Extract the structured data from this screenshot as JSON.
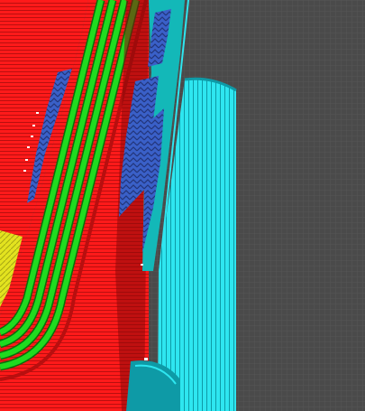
{
  "viewer": {
    "kind": "3d-print-slicer-layer-preview",
    "palette": {
      "background": "#4a4a4a",
      "grid_line": "#565656",
      "outer_wall": "#ff1a1a",
      "outer_wall_dark": "#b80f0f",
      "inner_wall": "#1fdb1f",
      "inner_wall_dark": "#0a6e0a",
      "support": "#3a60c8",
      "support_dark": "#22357a",
      "skirt_teal": "#13b8b8",
      "cyan_wall": "#2ee6f0",
      "cyan_wall_dark": "#0e9aa6",
      "infill": "#e3e31f",
      "seam_marker": "#ffffff"
    }
  }
}
